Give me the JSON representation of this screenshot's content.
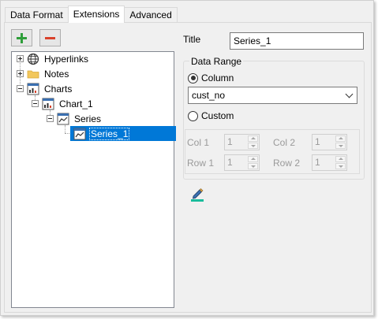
{
  "tabs": [
    {
      "label": "Data Format",
      "active": false
    },
    {
      "label": "Extensions",
      "active": true
    },
    {
      "label": "Advanced",
      "active": false
    }
  ],
  "toolbar": {
    "add_icon": "plus-icon",
    "remove_icon": "minus-icon"
  },
  "tree": {
    "hyperlinks": "Hyperlinks",
    "notes": "Notes",
    "charts": "Charts",
    "chart_1": "Chart_1",
    "series": "Series",
    "series_1": "Series_1"
  },
  "form": {
    "title_label": "Title",
    "title_value": "Series_1",
    "data_range_label": "Data Range",
    "column_label": "Column",
    "column_selected": true,
    "column_value": "cust_no",
    "custom_label": "Custom",
    "custom_selected": false,
    "col1_label": "Col 1",
    "col1_value": "1",
    "col2_label": "Col 2",
    "col2_value": "1",
    "row1_label": "Row 1",
    "row1_value": "1",
    "row2_label": "Row 2",
    "row2_value": "1"
  },
  "colors": {
    "selection": "#0078d7",
    "add": "#2e9e3a",
    "remove": "#d9412b",
    "accent_teal": "#1abc9c"
  }
}
